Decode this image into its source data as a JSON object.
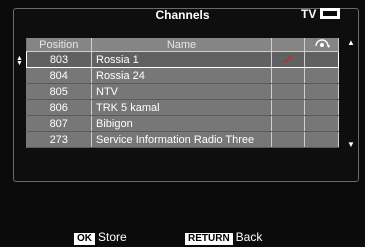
{
  "header": {
    "title": "Channels",
    "mode_label": "TV"
  },
  "table": {
    "columns": {
      "position": "Position",
      "name": "Name",
      "fav_icon": "broadcast-signal-icon"
    },
    "rows": [
      {
        "position": "803",
        "name": "Rossia 1",
        "checked": true,
        "selected": true
      },
      {
        "position": "804",
        "name": "Rossia 24",
        "checked": false,
        "selected": false
      },
      {
        "position": "805",
        "name": "NTV",
        "checked": false,
        "selected": false
      },
      {
        "position": "806",
        "name": "TRK 5 kamal",
        "checked": false,
        "selected": false
      },
      {
        "position": "807",
        "name": "Bibigon",
        "checked": false,
        "selected": false
      },
      {
        "position": "273",
        "name": "Service Information Radio Three",
        "checked": false,
        "selected": false
      }
    ]
  },
  "footer": {
    "ok_key": "OK",
    "ok_label": "Store",
    "return_key": "RETURN",
    "return_label": "Back"
  },
  "colors": {
    "check": "#e21b1b",
    "header_bg": "#858585",
    "row_bg": "#777777",
    "selected_row_bg": "#616161"
  }
}
